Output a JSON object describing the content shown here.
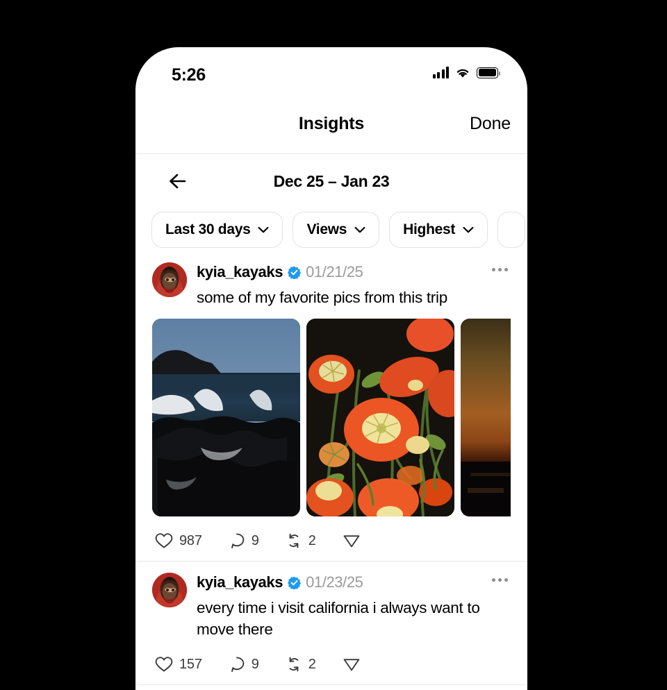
{
  "status_bar": {
    "time": "5:26",
    "cellular_icon": "cellular-bars-icon",
    "wifi_icon": "wifi-icon",
    "battery_icon": "battery-icon"
  },
  "nav": {
    "title": "Insights",
    "done_label": "Done"
  },
  "subheader": {
    "back_icon": "back-arrow-icon",
    "date_range": "Dec 25 – Jan 23"
  },
  "filters": [
    {
      "label": "Last 30 days",
      "icon": "chevron-down-icon"
    },
    {
      "label": "Views",
      "icon": "chevron-down-icon"
    },
    {
      "label": "Highest",
      "icon": "chevron-down-icon"
    },
    {
      "label": "",
      "icon": "chevron-down-icon"
    }
  ],
  "posts": [
    {
      "username": "kyia_kayaks",
      "verified": true,
      "verified_color": "#1d9bf0",
      "date": "01/21/25",
      "text": "some of my favorite pics from this trip",
      "more_icon": "more-options-icon",
      "media": [
        {
          "alt": "ocean waves crashing on dark rocks with sea stack"
        },
        {
          "alt": "orange poppy flowers in bloom"
        },
        {
          "alt": "dark sunset over water"
        }
      ],
      "engagement": {
        "likes": "987",
        "comments": "9",
        "reposts": "2",
        "like_icon": "heart-icon",
        "comment_icon": "comment-icon",
        "repost_icon": "repost-icon",
        "share_icon": "share-icon"
      }
    },
    {
      "username": "kyia_kayaks",
      "verified": true,
      "verified_color": "#1d9bf0",
      "date": "01/23/25",
      "text": "every time i visit california i always want to move there",
      "more_icon": "more-options-icon",
      "media": [],
      "engagement": {
        "likes": "157",
        "comments": "9",
        "reposts": "2",
        "like_icon": "heart-icon",
        "comment_icon": "comment-icon",
        "repost_icon": "repost-icon",
        "share_icon": "share-icon"
      }
    }
  ]
}
